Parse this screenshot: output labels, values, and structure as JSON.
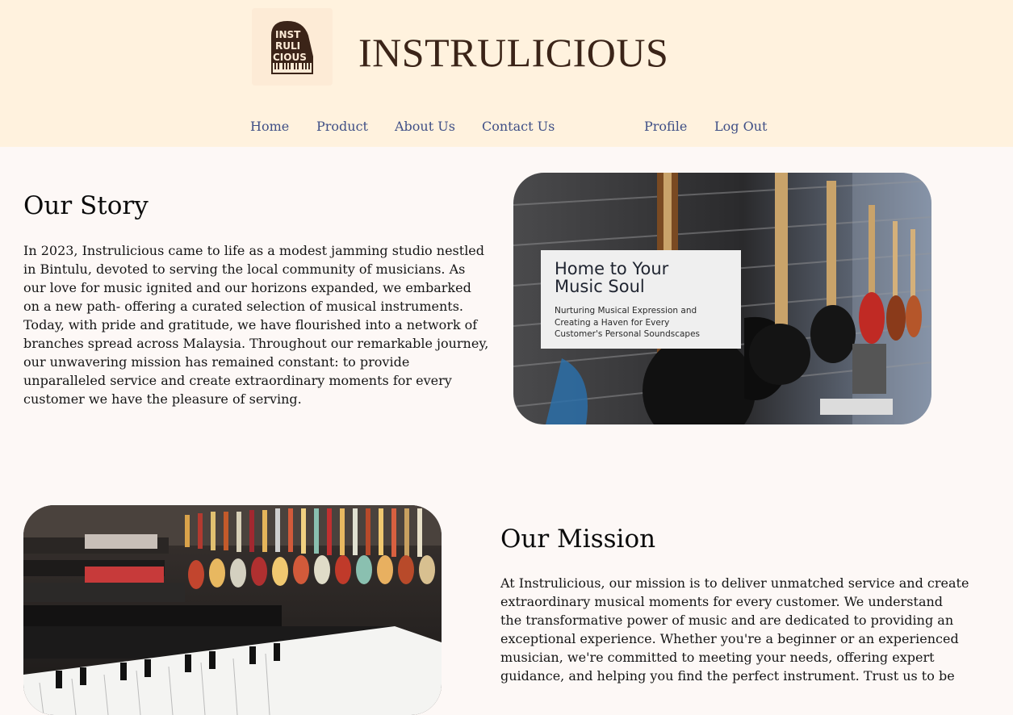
{
  "header": {
    "logo_lines": [
      "INST",
      "RULI",
      "CIOUS"
    ],
    "brand_name": "INSTRULICIOUS"
  },
  "nav": {
    "home": "Home",
    "product": "Product",
    "about": "About Us",
    "contact": "Contact Us",
    "profile": "Profile",
    "logout": "Log Out"
  },
  "story": {
    "title": "Our Story",
    "lines": [
      "In 2023, Instrulicious came to life as a modest jamming studio nestled",
      "in Bintulu, devoted to serving the local community of musicians. As",
      "our love for music ignited and our horizons expanded, we embarked",
      "on a new path- offering a curated selection of musical instruments.",
      "Today, with pride and gratitude, we have flourished into a network of",
      "branches spread across Malaysia. Throughout our remarkable journey,",
      "our unwavering mission has remained constant: to provide",
      "unparalleled service and create extraordinary moments for every",
      "customer we have the pleasure of serving."
    ],
    "image_caption_title_1": "Home to Your",
    "image_caption_title_2": "Music Soul",
    "image_caption_sub_1": "Nurturing Musical Expression and",
    "image_caption_sub_2": "Creating a Haven for Every",
    "image_caption_sub_3": "Customer's Personal Soundscapes"
  },
  "mission": {
    "title": "Our Mission",
    "lines": [
      "At Instrulicious, our mission is to deliver unmatched service and create",
      "extraordinary musical moments for every customer. We understand",
      "the transformative power of music and are dedicated to providing an",
      "exceptional experience. Whether you're a beginner or an experienced",
      "musician, we're committed to meeting your needs, offering expert",
      "guidance, and helping you find the perfect instrument. Trust us to be"
    ]
  },
  "colors": {
    "header_bg": "#fff2de",
    "page_bg": "#fdf8f6",
    "nav_link": "#3f4f86",
    "brand": "#3b2418"
  }
}
